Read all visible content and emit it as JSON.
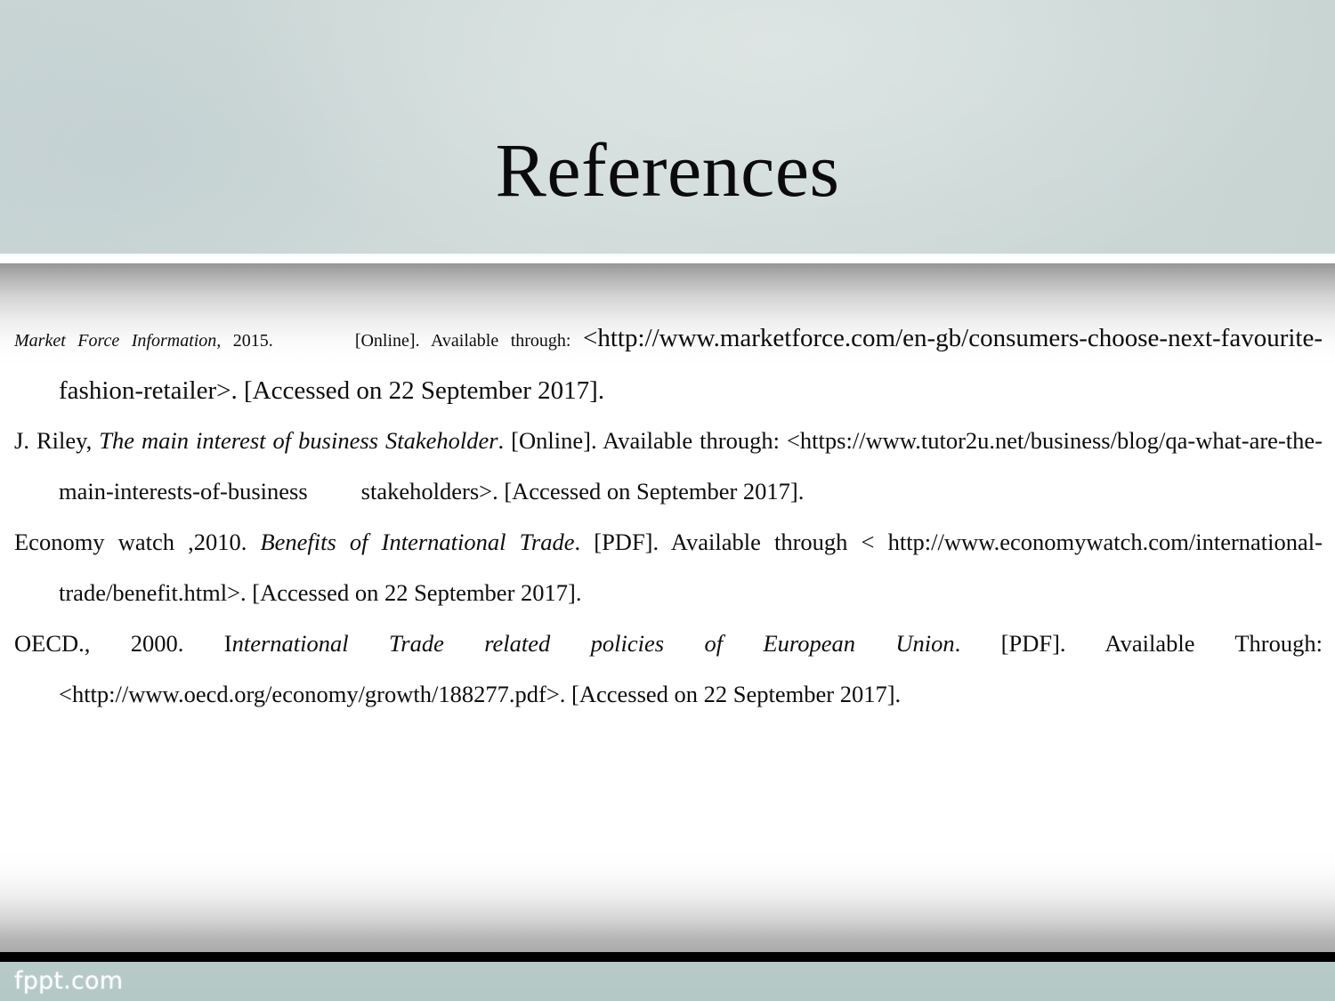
{
  "slide": {
    "title": "References",
    "footer_text": "fppt.com",
    "colors": {
      "header_bg": "#ccd8d6",
      "footer_bg": "#b5c9c7",
      "bar": "#000000",
      "text": "#0d0d0d"
    }
  },
  "references": [
    {
      "id": "market-force-information",
      "segments": [
        {
          "text": "Market Force Information,",
          "style": "italic-small"
        },
        {
          "text": " 2015.",
          "style": "small"
        },
        {
          "text": "GAP",
          "style": "gap"
        },
        {
          "text": "[Online]. Available through: ",
          "style": "small"
        },
        {
          "text": "<http://www.marketforce.com/en-gb/consumers-choose-next-favourite-fashion-retailer>. [Accessed on 22 September 2017].",
          "style": "big"
        }
      ],
      "plain": "Market Force Information, 2015. [Online]. Available through: <http://www.marketforce.com/en-gb/consumers-choose-next-favourite-fashion-retailer>. [Accessed on 22 September 2017]."
    },
    {
      "id": "j-riley",
      "segments": [
        {
          "text": "J. Riley, ",
          "style": "normal"
        },
        {
          "text": "The main interest of business Stakeholder",
          "style": "italic"
        },
        {
          "text": ". [Online]. Available through: <https://www.tutor2u.net/business/blog/qa-what-are-the-main-interests-of-business ",
          "style": "normal"
        },
        {
          "text": "GAPSM",
          "style": "gap-sm"
        },
        {
          "text": "stakeholders>. [Accessed on September 2017].",
          "style": "normal"
        }
      ],
      "plain": "J. Riley, The main interest of business Stakeholder. [Online]. Available through: <https://www.tutor2u.net/business/blog/qa-what-are-the-main-interests-of-business stakeholders>. [Accessed on September 2017]."
    },
    {
      "id": "economy-watch",
      "segments": [
        {
          "text": "Economy watch ,2010. ",
          "style": "normal"
        },
        {
          "text": "Benefits of International Trade",
          "style": "italic"
        },
        {
          "text": ". [PDF]. Available through < http://www.economywatch.com/international-trade/benefit.html>. [Accessed on 22 September 2017].",
          "style": "normal"
        }
      ],
      "plain": "Economy watch ,2010. Benefits of International Trade. [PDF]. Available through < http://www.economywatch.com/international-trade/benefit.html>. [Accessed on 22 September 2017]."
    },
    {
      "id": "oecd",
      "segments": [
        {
          "text": "OECD., 2000. I",
          "style": "normal"
        },
        {
          "text": "nternational Trade related policies of European Union",
          "style": "italic"
        },
        {
          "text": ". [PDF]. Available Through: <http://www.oecd.org/economy/growth/188277.pdf>. [Accessed on 22 September 2017].",
          "style": "normal"
        }
      ],
      "plain": "OECD., 2000. International Trade related policies of European Union. [PDF]. Available Through: <http://www.oecd.org/economy/growth/188277.pdf>. [Accessed on 22 September 2017]."
    }
  ],
  "ref_parts": {
    "r1_a": "Market Force Information,",
    "r1_b": " 2015.",
    "r1_c": "[Online]. Available through: ",
    "r1_d": "<http://www.marketforce.com/en-gb/consumers-choose-next-favourite-fashion-retailer>. [Accessed on 22 September 2017].",
    "r2_a": "J. Riley, ",
    "r2_b": "The main interest of business Stakeholder",
    "r2_c": ". [Online]. Available through: <https://www.tutor2u.net/business/blog/qa-what-are-the-main-interests-of-business",
    "r2_d": "stakeholders>. [Accessed on September 2017].",
    "r3_a": "Economy watch ,2010. ",
    "r3_b": "Benefits of International Trade",
    "r3_c": ". [PDF]. Available through < http://www.economywatch.com/international-trade/benefit.html>. [Accessed on 22 September 2017].",
    "r4_a": "OECD., 2000. I",
    "r4_b": "nternational Trade related policies of European Union",
    "r4_c": ". [PDF]. Available Through: <http://www.oecd.org/economy/growth/188277.pdf>. [Accessed on 22 September 2017]."
  }
}
